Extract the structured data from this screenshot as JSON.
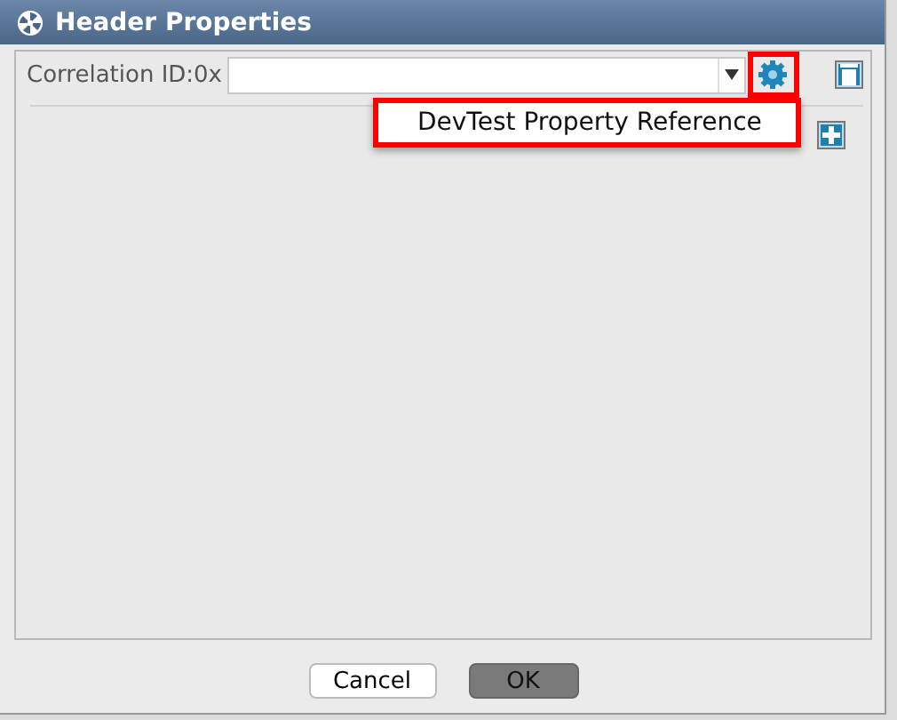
{
  "window": {
    "title": "Header Properties"
  },
  "field": {
    "label": "Correlation ID:0x",
    "highlighted_button": true
  },
  "menu": {
    "items": [
      {
        "label": "DevTest Property Reference",
        "highlighted": true
      }
    ]
  },
  "buttons": [
    {
      "label": "Cancel",
      "kind": "normal"
    },
    {
      "label": "OK",
      "kind": "default"
    }
  ]
}
